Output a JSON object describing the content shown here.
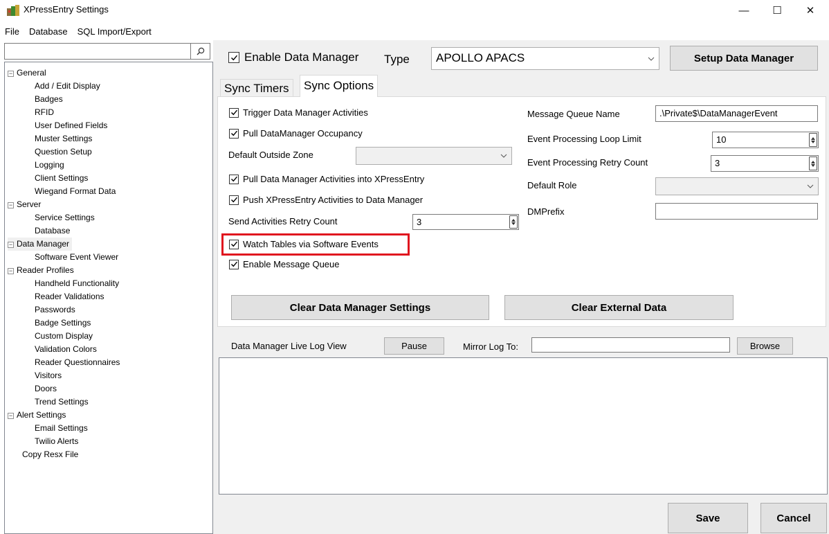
{
  "window": {
    "title": "XPressEntry Settings",
    "minimize": "—",
    "maximize": "☐",
    "close": "✕"
  },
  "menu": [
    "File",
    "Database",
    "SQL Import/Export"
  ],
  "search": {
    "value": "",
    "placeholder": ""
  },
  "tree": {
    "general": "General",
    "general_items": [
      "Add / Edit Display",
      "Badges",
      "RFID",
      "User Defined Fields",
      "Muster Settings",
      "Question Setup",
      "Logging",
      "Client Settings",
      "Wiegand Format Data"
    ],
    "server": "Server",
    "server_items": [
      "Service Settings",
      "Database"
    ],
    "data_manager": "Data Manager",
    "data_manager_items": [
      "Software Event Viewer"
    ],
    "reader_profiles": "Reader Profiles",
    "reader_items": [
      "Handheld Functionality",
      "Reader Validations",
      "Passwords",
      "Badge Settings",
      "Custom Display",
      "Validation Colors",
      "Reader Questionnaires",
      "Visitors",
      "Doors",
      "Trend Settings"
    ],
    "alert_settings": "Alert Settings",
    "alert_items": [
      "Email Settings",
      "Twilio Alerts"
    ],
    "copy_resx": "Copy Resx File"
  },
  "header": {
    "enable_data_manager": "Enable Data Manager",
    "type_label": "Type",
    "type_value": "APOLLO APACS",
    "setup_button": "Setup Data Manager"
  },
  "tabs": [
    "Sync Timers",
    "Sync Options"
  ],
  "options": {
    "trigger": "Trigger Data Manager Activities",
    "pull_occupancy": "Pull DataManager Occupancy",
    "default_outside_zone": "Default Outside Zone",
    "pull_activities": "Pull Data Manager Activities into XPressEntry",
    "push_activities": "Push XPressEntry Activities to Data Manager",
    "send_retry_label": "Send Activities Retry Count",
    "send_retry_value": "3",
    "watch_tables": "Watch Tables via Software Events",
    "enable_mq": "Enable Message Queue",
    "mq_name_label": "Message Queue Name",
    "mq_name_value": ".\\Private$\\DataManagerEvent",
    "loop_limit_label": "Event Processing Loop Limit",
    "loop_limit_value": "10",
    "retry_count_label": "Event Processing Retry Count",
    "retry_count_value": "3",
    "default_role_label": "Default Role",
    "dmprefix_label": "DMPrefix",
    "dmprefix_value": "",
    "clear_dm_button": "Clear Data Manager Settings",
    "clear_ext_button": "Clear External Data"
  },
  "log": {
    "label": "Data Manager Live Log View",
    "pause": "Pause",
    "mirror_label": "Mirror Log To:",
    "mirror_value": "",
    "browse": "Browse"
  },
  "footer": {
    "save": "Save",
    "cancel": "Cancel"
  },
  "colors": {
    "highlight": "#e0141e",
    "panel_bg": "#f0f0f0",
    "button_bg": "#e1e1e1"
  }
}
